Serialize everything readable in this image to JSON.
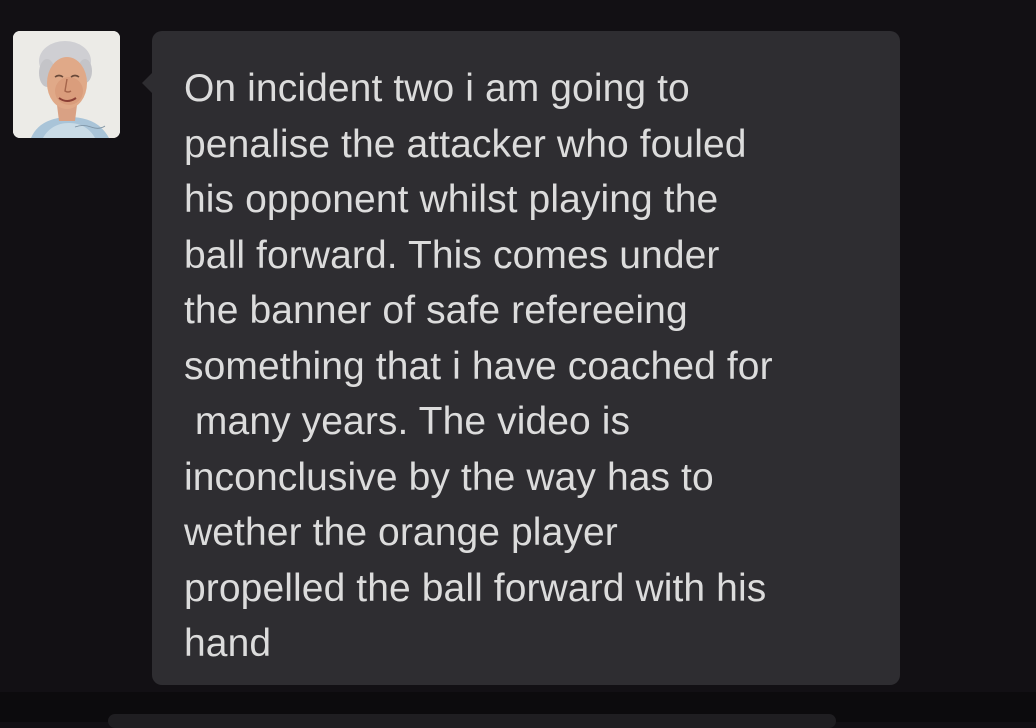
{
  "message": {
    "sender_avatar_icon": "portrait-avatar-icon",
    "text_lines": [
      "On incident two i am going to",
      "penalise the attacker who fouled",
      "his opponent whilst playing the",
      "ball forward. This comes under",
      "the banner of safe refereeing",
      "something that i have coached for",
      " many years. The video is",
      "inconclusive by the way has to",
      "wether the orange player",
      "propelled the ball forward with his",
      "hand"
    ]
  },
  "colors": {
    "background": "#121014",
    "bubble": "#2e2d31",
    "text": "#dcdcdc"
  }
}
